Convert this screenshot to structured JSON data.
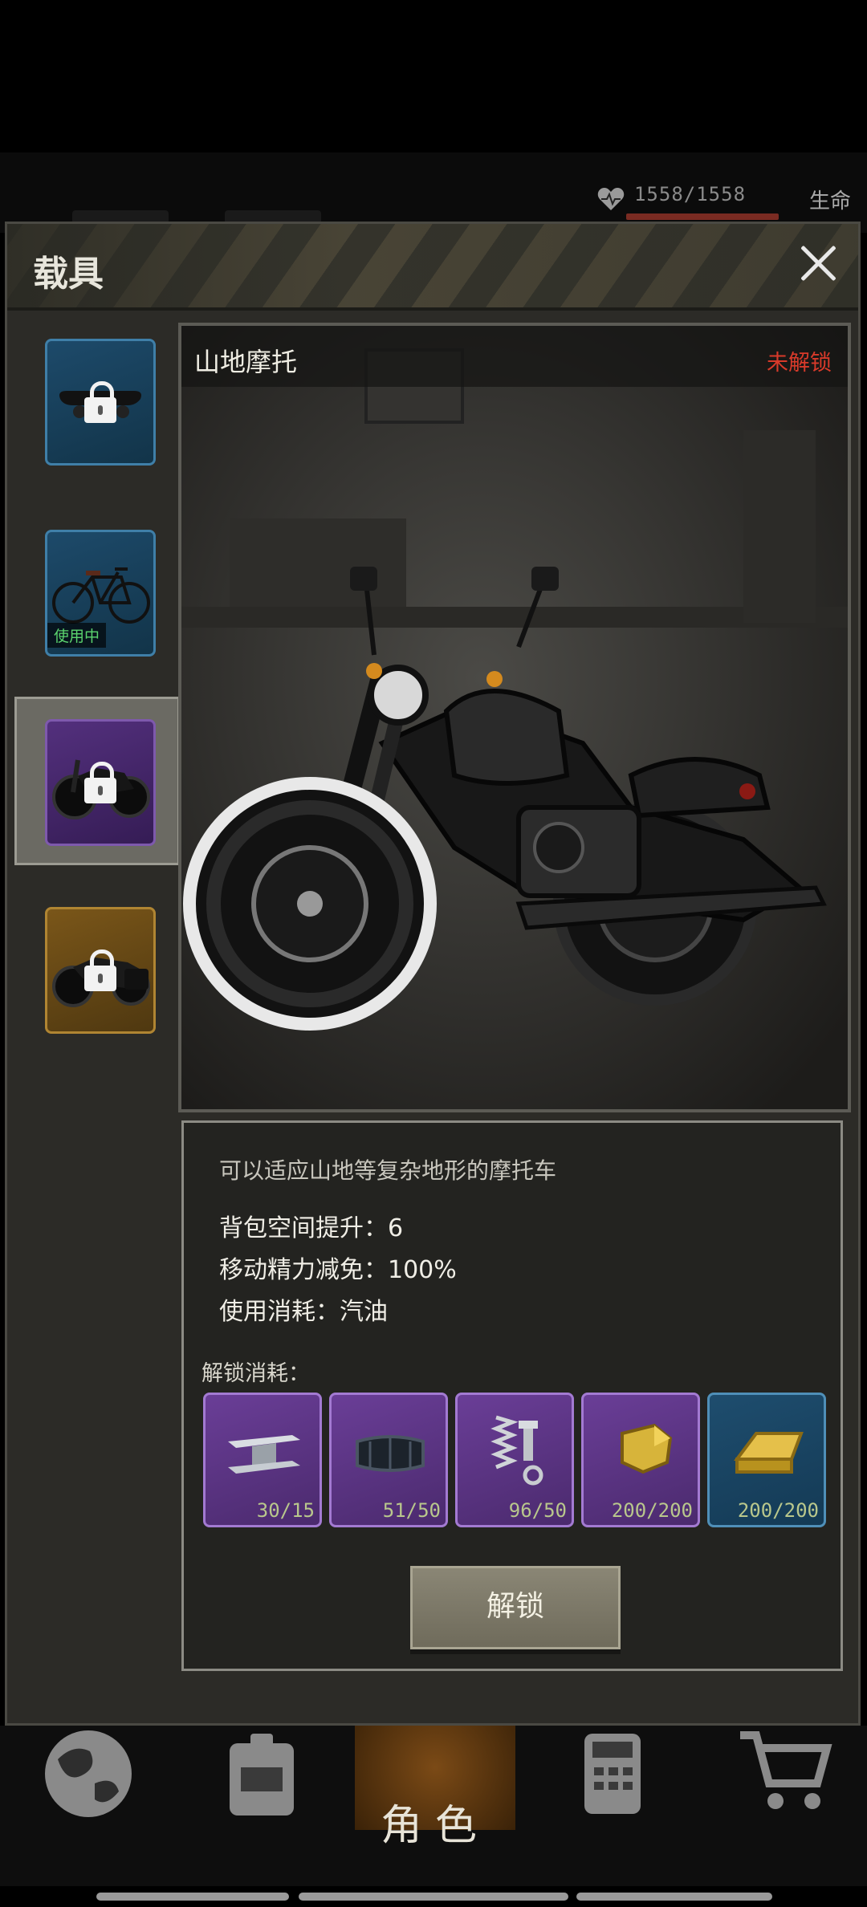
{
  "hud": {
    "hp": "1558/1558",
    "life_label": "生命"
  },
  "panel": {
    "title": "载具"
  },
  "sidebar": {
    "items": [
      {
        "name": "skateboard",
        "rarity": "blue",
        "locked": true
      },
      {
        "name": "bicycle",
        "rarity": "blue",
        "locked": false,
        "badge": "使用中"
      },
      {
        "name": "mountain-motorcycle",
        "rarity": "purple",
        "locked": true,
        "selected": true
      },
      {
        "name": "cruiser-motorcycle",
        "rarity": "gold",
        "locked": true
      }
    ]
  },
  "vehicle": {
    "name": "山地摩托",
    "status": "未解锁",
    "description": "可以适应山地等复杂地形的摩托车",
    "stats": [
      "背包空间提升：6",
      "移动精力减免：100%",
      "使用消耗：汽油"
    ]
  },
  "unlock": {
    "label": "解锁消耗：",
    "button": "解锁",
    "resources": [
      {
        "icon": "steel-beam-icon",
        "count": "30/15",
        "rarity": "purple"
      },
      {
        "icon": "rubber-tire-icon",
        "count": "51/50",
        "rarity": "purple"
      },
      {
        "icon": "spring-bolt-icon",
        "count": "96/50",
        "rarity": "purple"
      },
      {
        "icon": "gold-ore-icon",
        "count": "200/200",
        "rarity": "purple"
      },
      {
        "icon": "gold-bar-icon",
        "count": "200/200",
        "rarity": "blue"
      }
    ]
  },
  "nav": {
    "active_label": "角色"
  },
  "colors": {
    "locked_status": "#d83a2a",
    "in_use": "#5bd46e",
    "purple": "#7e59ad",
    "blue": "#3f7fa8",
    "gold": "#b08532"
  }
}
